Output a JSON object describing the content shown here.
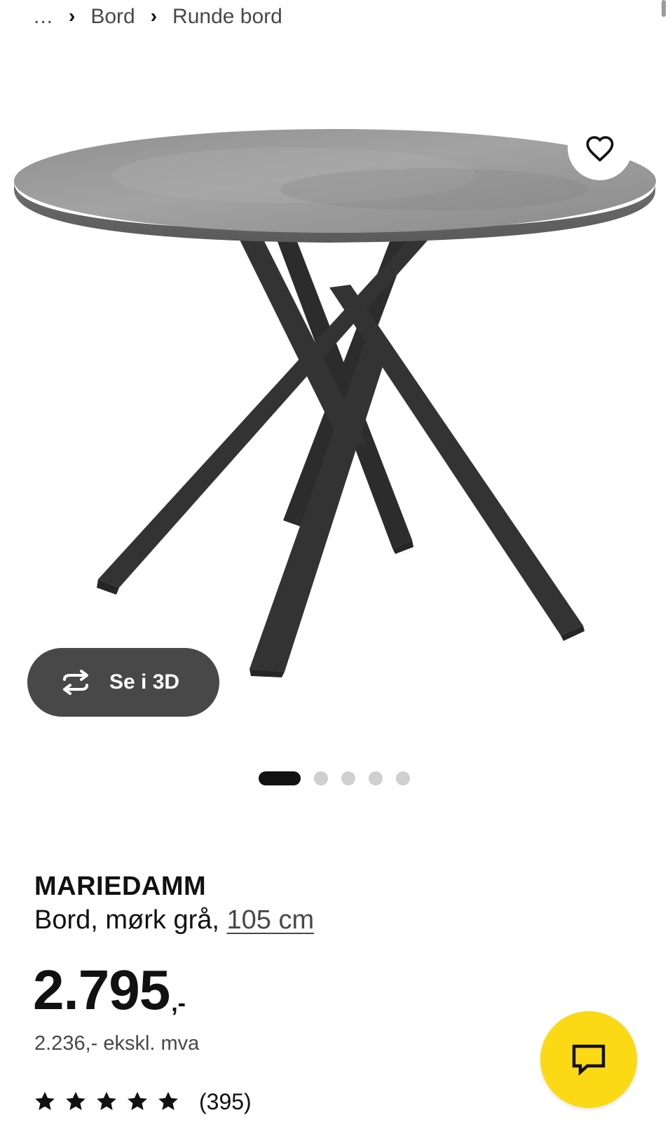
{
  "breadcrumb": {
    "ellipsis": "...",
    "items": [
      "Bord",
      "Runde bord"
    ]
  },
  "image": {
    "favourite_icon": "heart-outline-icon",
    "view_3d_label": "Se i 3D",
    "view_3d_icon": "rotate-arrows-icon",
    "carousel": {
      "total": 5,
      "active_index": 0
    }
  },
  "product": {
    "name": "MARIEDAMM",
    "description": "Bord, mørk grå,",
    "size_link": "105 cm",
    "price_integer": "2.795",
    "price_suffix": ",-",
    "price_ex_vat": "2.236,- ekskl. mva",
    "rating": {
      "stars": 5,
      "count": "(395)"
    }
  },
  "chat": {
    "icon": "chat-bubble-icon",
    "color": "#fbd914"
  },
  "colors": {
    "text": "#111111",
    "muted": "#484848",
    "accent_yellow": "#fbd914",
    "button_dark": "#484848"
  }
}
